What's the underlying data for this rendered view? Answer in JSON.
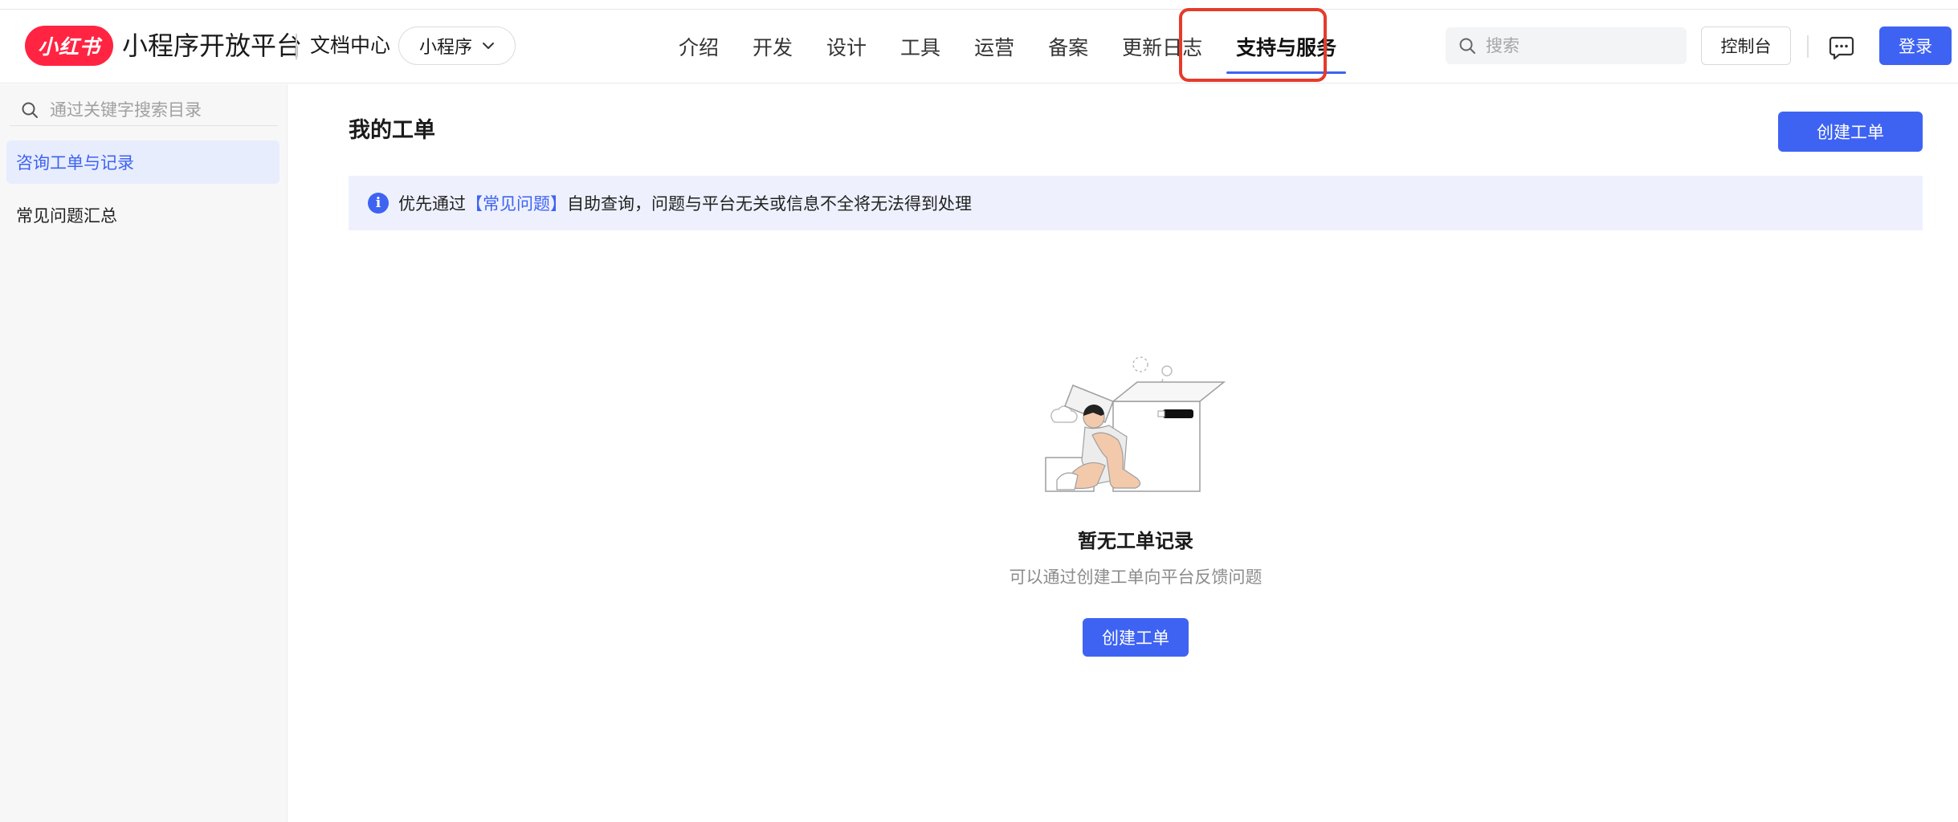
{
  "header": {
    "logo_text": "小红书",
    "platform_title": "小程序开放平台",
    "doc_center": "文档中心",
    "product_select": "小程序",
    "nav": [
      {
        "label": "介绍"
      },
      {
        "label": "开发"
      },
      {
        "label": "设计"
      },
      {
        "label": "工具"
      },
      {
        "label": "运营"
      },
      {
        "label": "备案"
      },
      {
        "label": "更新日志"
      },
      {
        "label": "支持与服务",
        "active": true
      }
    ],
    "search_placeholder": "搜索",
    "console_label": "控制台",
    "login_label": "登录"
  },
  "sidebar": {
    "search_placeholder": "通过关键字搜索目录",
    "items": [
      {
        "label": "咨询工单与记录",
        "active": true
      },
      {
        "label": "常见问题汇总"
      }
    ]
  },
  "main": {
    "title": "我的工单",
    "create_label": "创建工单",
    "notice": {
      "prefix": "优先通过",
      "link": "【常见问题】",
      "suffix": "自助查询，问题与平台无关或信息不全将无法得到处理"
    },
    "empty": {
      "title": "暂无工单记录",
      "subtitle": "可以通过创建工单向平台反馈问题",
      "button": "创建工单"
    }
  },
  "colors": {
    "accent": "#3e63f2",
    "brand": "#ff2442",
    "highlight": "#e53b2b",
    "notice_bg": "#eef1fd"
  },
  "icons": [
    "search-icon",
    "chevron-down-icon",
    "message-icon",
    "info-icon",
    "empty-box-illustration"
  ]
}
